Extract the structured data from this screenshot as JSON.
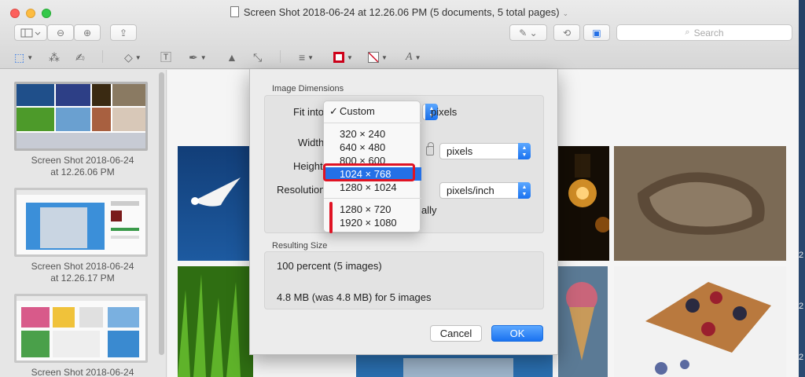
{
  "window": {
    "title": "Screen Shot 2018-06-24 at 12.26.06 PM (5 documents, 5 total pages)"
  },
  "toolbar": {
    "search_placeholder": "Search"
  },
  "sidebar": {
    "items": [
      {
        "label_line1": "Screen Shot 2018-06-24",
        "label_line2": "at 12.26.06 PM"
      },
      {
        "label_line1": "Screen Shot 2018-06-24",
        "label_line2": "at 12.26.17 PM"
      },
      {
        "label_line1": "Screen Shot 2018-06-24",
        "label_line2": ""
      }
    ]
  },
  "dialog": {
    "image_dimensions_label": "Image Dimensions",
    "fit_into_label": "Fit into",
    "pixels_label": "pixels",
    "width_label": "Width",
    "height_label": "Height",
    "resolution_label": "Resolution",
    "width_unit": "pixels",
    "resolution_unit": "pixels/inch",
    "resample_fragment": "ally",
    "resulting_size_label": "Resulting Size",
    "percent_text": "100 percent (5 images)",
    "size_text": "4.8 MB (was 4.8 MB) for 5 images",
    "cancel_label": "Cancel",
    "ok_label": "OK"
  },
  "fit_menu": {
    "selected": "Custom",
    "group1": [
      "320 × 240",
      "640 × 480",
      "800 × 600",
      "1024 × 768",
      "1280 × 1024"
    ],
    "group2": [
      "1280 × 720",
      "1920 × 1080"
    ],
    "highlighted": "1024 × 768"
  },
  "edge_labels": [
    "2",
    "2",
    "2"
  ],
  "colors": {
    "accent": "#2470e6",
    "annotation": "#e01324"
  }
}
